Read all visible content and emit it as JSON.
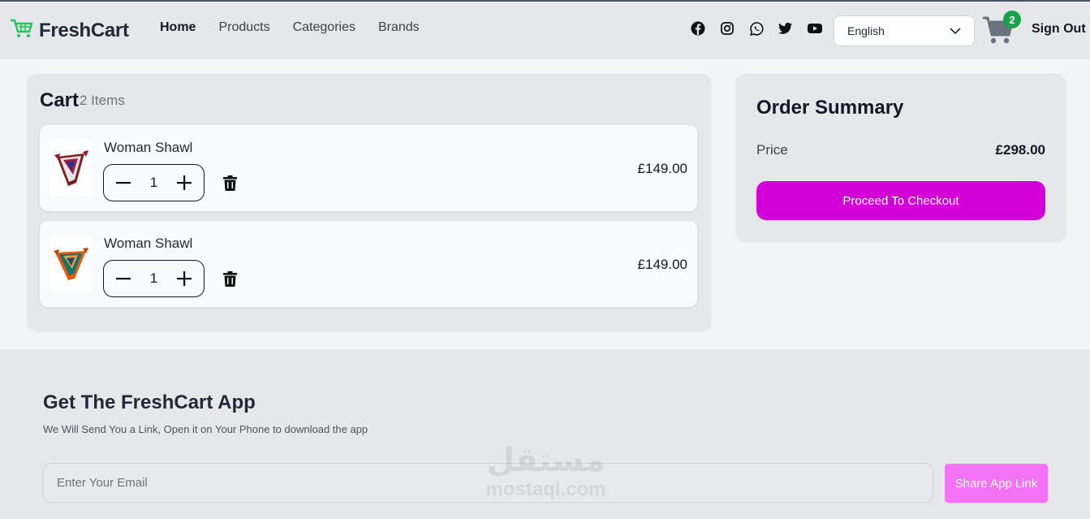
{
  "navbar": {
    "brand": "FreshCart",
    "links": [
      "Home",
      "Products",
      "Categories",
      "Brands"
    ],
    "language": "English",
    "cart_count": "2",
    "signout": "Sign Out",
    "socials": [
      "facebook-icon",
      "instagram-icon",
      "whatsapp-icon",
      "twitter-icon",
      "youtube-icon"
    ]
  },
  "cart": {
    "title": "Cart",
    "count_label": "2 Items",
    "items": [
      {
        "name": "Woman Shawl",
        "quantity": "1",
        "price": "£149.00"
      },
      {
        "name": "Woman Shawl",
        "quantity": "1",
        "price": "£149.00"
      }
    ]
  },
  "summary": {
    "title": "Order Summary",
    "price_label": "Price",
    "price_value": "£298.00",
    "checkout_label": "Proceed To Checkout"
  },
  "footer": {
    "title": "Get The FreshCart App",
    "subtitle": "We Will Send You a Link, Open it on Your Phone to download the app",
    "email_placeholder": "Enter Your Email",
    "share_label": "Share App Link"
  },
  "watermark": {
    "arabic": "مستقل",
    "latin": "mostaql.com"
  },
  "colors": {
    "accent": "#d300d8",
    "share": "#f472f6",
    "badge": "#16a34a",
    "brand_icon": "#22c55e"
  }
}
